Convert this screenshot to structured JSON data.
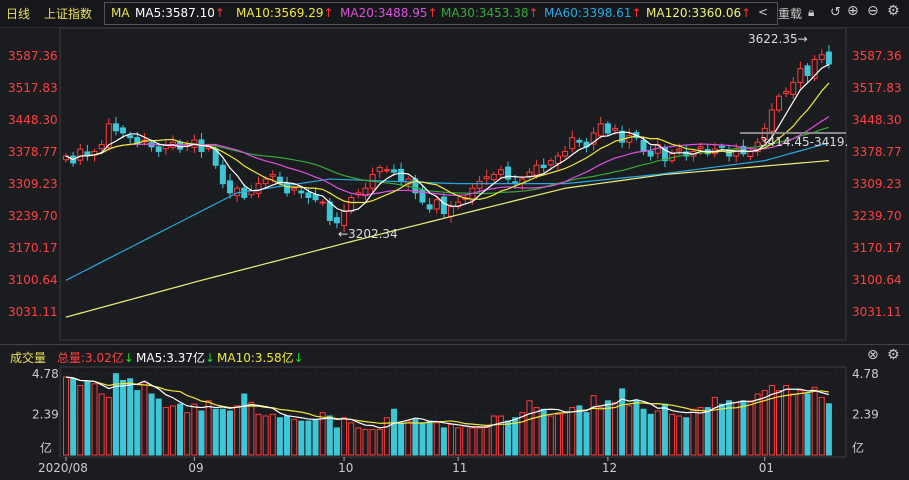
{
  "topbar": {
    "period": "日线",
    "index": "上证指数",
    "ma_label": "MA",
    "ma": [
      {
        "label": "MA5:3587.10",
        "color": "#ffffff"
      },
      {
        "label": "MA10:3569.29",
        "color": "#f0e93a"
      },
      {
        "label": "MA20:3488.95",
        "color": "#e04fe0"
      },
      {
        "label": "MA30:3453.38",
        "color": "#3aa83a"
      },
      {
        "label": "MA60:3398.61",
        "color": "#29a8e0"
      },
      {
        "label": "MA120:3360.06",
        "color": "#f0f07a"
      }
    ],
    "up_arrow": "↑",
    "prev": "<",
    "reload": "重载"
  },
  "volume_header": {
    "title": "成交量",
    "total": "总量:3.02亿",
    "ma5": "MA5:3.37亿",
    "ma10": "MA10:3.58亿",
    "down_arrow": "↓"
  },
  "colors": {
    "up": "#ff3b3b",
    "down": "#3ec6d6",
    "bg": "#1b1c20",
    "grid": "#2c2d33"
  },
  "chart_data": {
    "type": "candlestick",
    "title": "上证指数 日线",
    "price_ticks": [
      "3587.36",
      "3517.83",
      "3448.30",
      "3378.77",
      "3309.23",
      "3239.70",
      "3170.17",
      "3100.64",
      "3031.11"
    ],
    "price_tick_values": [
      3587.36,
      3517.83,
      3448.3,
      3378.77,
      3309.23,
      3239.7,
      3170.17,
      3100.64,
      3031.11
    ],
    "x_labels": [
      {
        "label": "2020/08",
        "index": 0
      },
      {
        "label": "09",
        "index": 18
      },
      {
        "label": "10",
        "index": 39
      },
      {
        "label": "11",
        "index": 55
      },
      {
        "label": "12",
        "index": 76
      },
      {
        "label": "01",
        "index": 98
      }
    ],
    "close": [
      3370,
      3355,
      3385,
      3372,
      3380,
      3395,
      3440,
      3425,
      3420,
      3410,
      3395,
      3405,
      3390,
      3380,
      3395,
      3400,
      3385,
      3395,
      3405,
      3380,
      3390,
      3350,
      3310,
      3290,
      3300,
      3280,
      3295,
      3310,
      3320,
      3330,
      3310,
      3290,
      3300,
      3290,
      3280,
      3275,
      3270,
      3230,
      3225,
      3250,
      3280,
      3290,
      3300,
      3330,
      3345,
      3340,
      3335,
      3315,
      3320,
      3290,
      3270,
      3255,
      3275,
      3245,
      3260,
      3270,
      3280,
      3300,
      3315,
      3325,
      3330,
      3340,
      3320,
      3310,
      3320,
      3335,
      3350,
      3345,
      3360,
      3370,
      3380,
      3410,
      3400,
      3390,
      3420,
      3440,
      3420,
      3430,
      3400,
      3415,
      3410,
      3380,
      3370,
      3395,
      3360,
      3375,
      3385,
      3370,
      3380,
      3390,
      3375,
      3385,
      3390,
      3370,
      3385,
      3375,
      3380,
      3400,
      3430,
      3470,
      3500,
      3510,
      3530,
      3560,
      3545,
      3580,
      3590,
      3570
    ],
    "ma60_points": [
      [
        0,
        3100
      ],
      [
        24,
        3290
      ],
      [
        37,
        3320
      ],
      [
        55,
        3310
      ],
      [
        70,
        3310
      ],
      [
        83,
        3330
      ],
      [
        98,
        3360
      ],
      [
        107,
        3398.61
      ]
    ],
    "ma120_points": [
      [
        0,
        3020
      ],
      [
        19,
        3100
      ],
      [
        44,
        3200
      ],
      [
        70,
        3300
      ],
      [
        84,
        3330
      ],
      [
        107,
        3360.06
      ]
    ],
    "annotations": {
      "high": "3622.35→",
      "low": "←3202.34",
      "range": "3414.45-3419."
    },
    "volume": [
      4.6,
      4.5,
      4.1,
      4.3,
      4.2,
      3.6,
      3.4,
      4.8,
      4.4,
      4.5,
      3.8,
      4.3,
      3.6,
      3.3,
      2.8,
      2.9,
      3.0,
      2.5,
      3.0,
      2.6,
      3.2,
      2.7,
      2.7,
      2.6,
      2.9,
      3.6,
      3.1,
      2.4,
      2.3,
      2.4,
      2.2,
      2.3,
      2.1,
      2.0,
      2.0,
      2.1,
      2.5,
      2.3,
      1.6,
      2.2,
      1.9,
      1.6,
      1.5,
      1.5,
      1.5,
      2.2,
      2.7,
      1.9,
      2.0,
      2.1,
      1.9,
      2.0,
      1.9,
      1.6,
      1.8,
      1.6,
      1.7,
      1.6,
      1.6,
      1.7,
      2.3,
      2.3,
      2.0,
      2.2,
      2.5,
      3.2,
      2.8,
      2.7,
      2.3,
      2.4,
      2.5,
      2.8,
      2.9,
      2.5,
      3.5,
      2.8,
      3.2,
      3.1,
      3.9,
      2.9,
      3.2,
      2.7,
      2.4,
      2.6,
      3.0,
      2.4,
      2.3,
      2.2,
      2.7,
      2.8,
      2.8,
      3.4,
      3.0,
      3.2,
      3.1,
      3.2,
      3.2,
      3.6,
      3.8,
      4.1,
      3.8,
      4.1,
      3.6,
      3.8,
      3.6,
      4.0,
      3.4,
      3.02
    ],
    "volume_ticks": [
      "4.78",
      "2.39",
      "亿"
    ],
    "volume_unit": "亿",
    "ylim": [
      3031.11,
      3587.36
    ],
    "volume_ylim": [
      0,
      4.78
    ]
  }
}
